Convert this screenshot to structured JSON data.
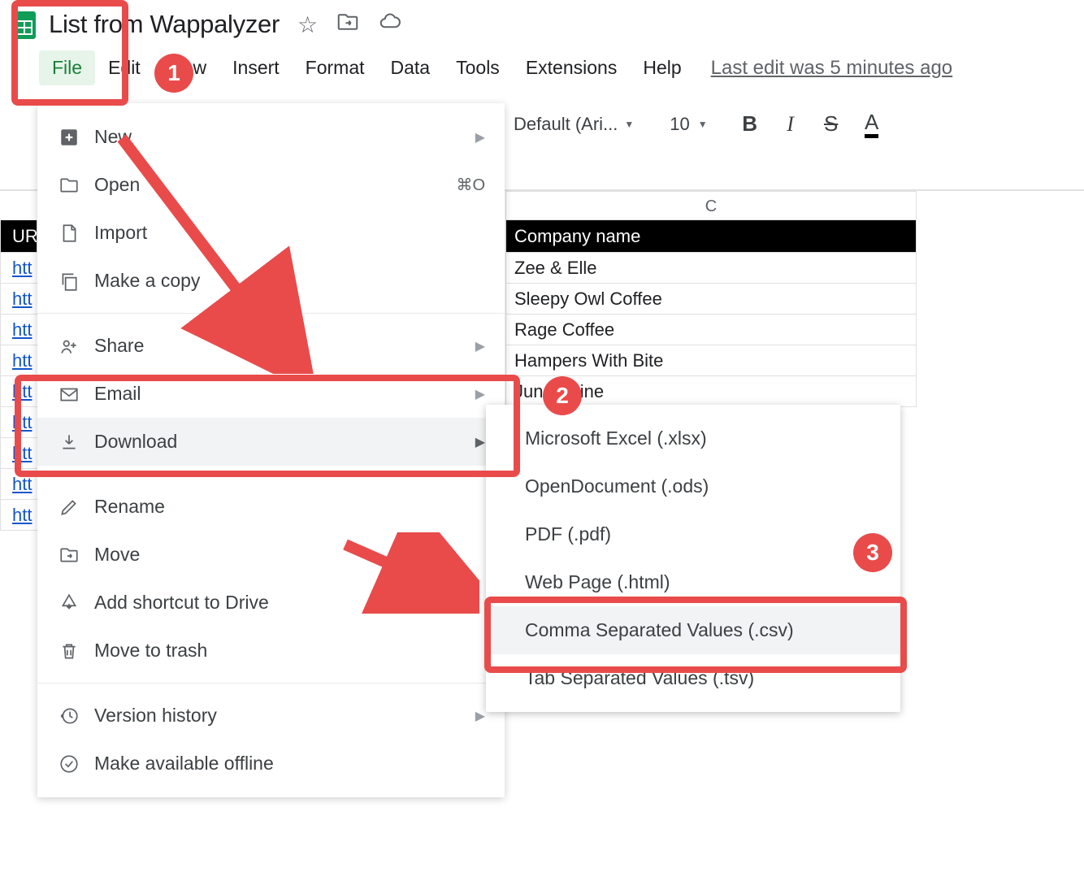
{
  "document": {
    "title": "List from Wappalyzer"
  },
  "menubar": {
    "file": "File",
    "edit": "Edit",
    "view": "View",
    "insert": "Insert",
    "format": "Format",
    "data": "Data",
    "tools": "Tools",
    "extensions": "Extensions",
    "help": "Help",
    "last_edit": "Last edit was 5 minutes ago"
  },
  "toolbar": {
    "font_name": "Default (Ari...",
    "font_size": "10",
    "bold": "B",
    "italic": "I",
    "strike": "S",
    "text_color": "A"
  },
  "file_menu": {
    "new": "New",
    "open": "Open",
    "open_shortcut": "⌘O",
    "import": "Import",
    "make_copy": "Make a copy",
    "share": "Share",
    "email": "Email",
    "download": "Download",
    "rename": "Rename",
    "move": "Move",
    "add_shortcut": "Add shortcut to Drive",
    "move_trash": "Move to trash",
    "version_history": "Version history",
    "available_offline": "Make available offline"
  },
  "download_submenu": {
    "xlsx": "Microsoft Excel (.xlsx)",
    "ods": "OpenDocument (.ods)",
    "pdf": "PDF (.pdf)",
    "html": "Web Page (.html)",
    "csv": "Comma Separated Values (.csv)",
    "tsv": "Tab Separated Values (.tsv)"
  },
  "sheet": {
    "column_letter": "C",
    "header_left": "URL",
    "header_c": "Company name",
    "rows_left": [
      "htt",
      "htt",
      "htt",
      "htt",
      "htt",
      "htt",
      "htt",
      "htt",
      "htt"
    ],
    "rows_c": [
      "Zee & Elle",
      "Sleepy Owl Coffee",
      "Rage Coffee",
      "Hampers With Bite",
      "June Shine"
    ]
  },
  "annotations": {
    "step1": "1",
    "step2": "2",
    "step3": "3"
  },
  "colors": {
    "highlight": "#E94B4B"
  }
}
